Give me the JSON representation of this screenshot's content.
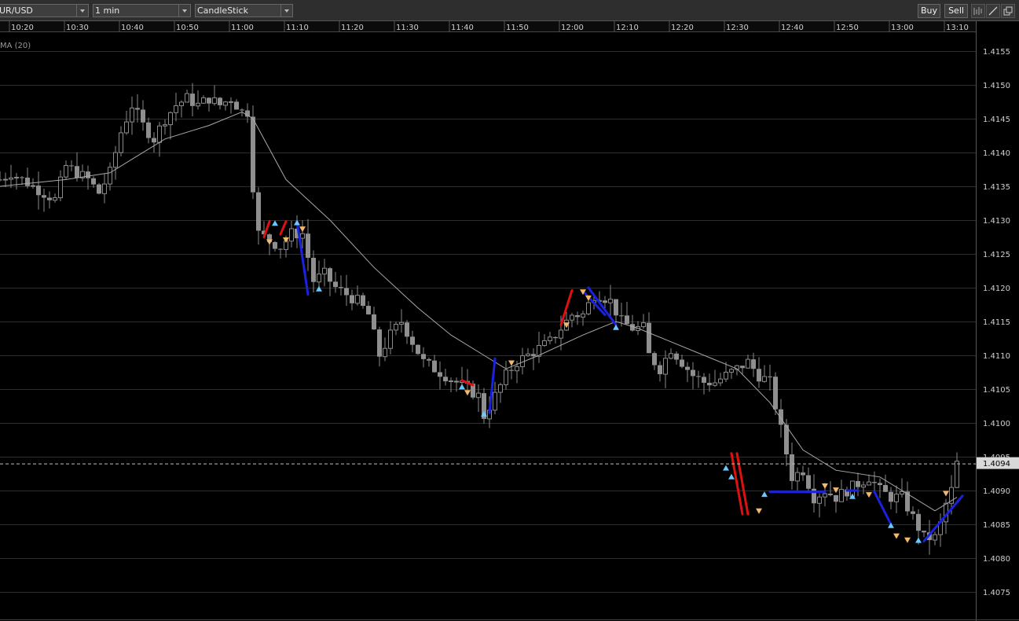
{
  "toolbar": {
    "symbol": "UR/USD",
    "interval": "1 min",
    "chart_style": "CandleStick",
    "buy_label": "Buy",
    "sell_label": "Sell",
    "icons": [
      "indicator-icon",
      "draw-line-icon",
      "popout-icon"
    ]
  },
  "indicator_label": "MA (20)",
  "colors": {
    "background": "#000000",
    "grid": "#2e2e2e",
    "candle": "#8a8a8a",
    "ma_line": "#a8a8a8",
    "signal_up": "#69c8ff",
    "signal_down": "#f5b769",
    "line_red": "#dd1111",
    "line_blue": "#1a22e0"
  },
  "chart_data": {
    "type": "candlestick",
    "symbol": "UR/USD",
    "interval": "1 min",
    "x_tick_labels": [
      "10:20",
      "10:30",
      "10:40",
      "10:50",
      "11:00",
      "11:10",
      "11:20",
      "11:30",
      "11:40",
      "11:50",
      "12:00",
      "12:10",
      "12:20",
      "12:30",
      "12:40",
      "12:50",
      "13:00",
      "13:10"
    ],
    "y_tick_labels": [
      "1.4155",
      "1.4150",
      "1.4145",
      "1.4140",
      "1.4135",
      "1.4130",
      "1.4125",
      "1.4120",
      "1.4115",
      "1.4110",
      "1.4105",
      "1.4100",
      "1.4095",
      "1.4090",
      "1.4085",
      "1.4080",
      "1.4075"
    ],
    "ylim": [
      1.40715,
      1.41615
    ],
    "xlim_minutes_from_10_20": [
      -2,
      172
    ],
    "current_price": "1.4094",
    "close_anchors": [
      [
        -2,
        1.4136
      ],
      [
        0,
        1.4137
      ],
      [
        2,
        1.4136
      ],
      [
        4,
        1.4135
      ],
      [
        6,
        1.4134
      ],
      [
        8,
        1.4133
      ],
      [
        10,
        1.4138
      ],
      [
        12,
        1.4137
      ],
      [
        14,
        1.4136
      ],
      [
        16,
        1.4134
      ],
      [
        18,
        1.4137
      ],
      [
        20,
        1.4143
      ],
      [
        22,
        1.4147
      ],
      [
        24,
        1.4144
      ],
      [
        26,
        1.4142
      ],
      [
        28,
        1.4145
      ],
      [
        30,
        1.4147
      ],
      [
        32,
        1.4148
      ],
      [
        34,
        1.4147
      ],
      [
        36,
        1.4148
      ],
      [
        38,
        1.4147
      ],
      [
        40,
        1.4148
      ],
      [
        42,
        1.4146
      ],
      [
        43,
        1.4146
      ],
      [
        44,
        1.4135
      ],
      [
        45,
        1.4128
      ],
      [
        47,
        1.4127
      ],
      [
        49,
        1.4126
      ],
      [
        51,
        1.4128
      ],
      [
        53,
        1.4128
      ],
      [
        55,
        1.4121
      ],
      [
        57,
        1.4122
      ],
      [
        59,
        1.412
      ],
      [
        61,
        1.4119
      ],
      [
        63,
        1.4118
      ],
      [
        65,
        1.4116
      ],
      [
        67,
        1.411
      ],
      [
        69,
        1.4113
      ],
      [
        71,
        1.4115
      ],
      [
        73,
        1.4112
      ],
      [
        75,
        1.4109
      ],
      [
        77,
        1.4108
      ],
      [
        79,
        1.4107
      ],
      [
        81,
        1.4106
      ],
      [
        83,
        1.4105
      ],
      [
        85,
        1.4104
      ],
      [
        86,
        1.4101
      ],
      [
        88,
        1.4104
      ],
      [
        90,
        1.4107
      ],
      [
        92,
        1.4109
      ],
      [
        94,
        1.411
      ],
      [
        96,
        1.4111
      ],
      [
        98,
        1.4112
      ],
      [
        100,
        1.4114
      ],
      [
        102,
        1.4116
      ],
      [
        104,
        1.4116
      ],
      [
        106,
        1.4119
      ],
      [
        107,
        1.4119
      ],
      [
        109,
        1.4118
      ],
      [
        111,
        1.4115
      ],
      [
        113,
        1.4114
      ],
      [
        115,
        1.4114
      ],
      [
        116,
        1.411
      ],
      [
        118,
        1.4108
      ],
      [
        120,
        1.4111
      ],
      [
        122,
        1.4109
      ],
      [
        124,
        1.4107
      ],
      [
        126,
        1.4106
      ],
      [
        128,
        1.4106
      ],
      [
        130,
        1.4107
      ],
      [
        132,
        1.4108
      ],
      [
        134,
        1.4109
      ],
      [
        136,
        1.4107
      ],
      [
        138,
        1.4106
      ],
      [
        140,
        1.4099
      ],
      [
        142,
        1.4092
      ],
      [
        144,
        1.4093
      ],
      [
        146,
        1.4089
      ],
      [
        148,
        1.409
      ],
      [
        150,
        1.4089
      ],
      [
        152,
        1.409
      ],
      [
        154,
        1.4091
      ],
      [
        156,
        1.4092
      ],
      [
        158,
        1.409
      ],
      [
        160,
        1.4089
      ],
      [
        162,
        1.4089
      ],
      [
        164,
        1.4086
      ],
      [
        166,
        1.4083
      ],
      [
        168,
        1.4083
      ],
      [
        169,
        1.4085
      ],
      [
        170,
        1.4088
      ],
      [
        171,
        1.409
      ],
      [
        172,
        1.4094
      ]
    ],
    "ma_line": {
      "name": "MA (20)",
      "points": [
        [
          -2,
          1.4135
        ],
        [
          10,
          1.4136
        ],
        [
          18,
          1.4137
        ],
        [
          22,
          1.4139
        ],
        [
          28,
          1.4142
        ],
        [
          36,
          1.4144
        ],
        [
          42,
          1.4146
        ],
        [
          44,
          1.4145
        ],
        [
          50,
          1.4136
        ],
        [
          58,
          1.413
        ],
        [
          66,
          1.4123
        ],
        [
          74,
          1.4117
        ],
        [
          80,
          1.4113
        ],
        [
          86,
          1.411
        ],
        [
          90,
          1.4108
        ],
        [
          96,
          1.411
        ],
        [
          104,
          1.4113
        ],
        [
          110,
          1.4115
        ],
        [
          114,
          1.4114
        ],
        [
          120,
          1.4112
        ],
        [
          126,
          1.411
        ],
        [
          132,
          1.4108
        ],
        [
          138,
          1.4103
        ],
        [
          144,
          1.4096
        ],
        [
          150,
          1.4093
        ],
        [
          158,
          1.4092
        ],
        [
          164,
          1.4089
        ],
        [
          168,
          1.4087
        ],
        [
          172,
          1.4089
        ]
      ]
    },
    "signals": [
      {
        "t": 47,
        "p": 1.41268,
        "dir": "down"
      },
      {
        "t": 48,
        "p": 1.41295,
        "dir": "up"
      },
      {
        "t": 50,
        "p": 1.41271,
        "dir": "down"
      },
      {
        "t": 52,
        "p": 1.41296,
        "dir": "up"
      },
      {
        "t": 53,
        "p": 1.41287,
        "dir": "down"
      },
      {
        "t": 56,
        "p": 1.41198,
        "dir": "up"
      },
      {
        "t": 82,
        "p": 1.41053,
        "dir": "up"
      },
      {
        "t": 83,
        "p": 1.41045,
        "dir": "down"
      },
      {
        "t": 86,
        "p": 1.41013,
        "dir": "up"
      },
      {
        "t": 91,
        "p": 1.41089,
        "dir": "down"
      },
      {
        "t": 101,
        "p": 1.41145,
        "dir": "down"
      },
      {
        "t": 104,
        "p": 1.41194,
        "dir": "down"
      },
      {
        "t": 105,
        "p": 1.41185,
        "dir": "down"
      },
      {
        "t": 110,
        "p": 1.41141,
        "dir": "up"
      },
      {
        "t": 130,
        "p": 1.40933,
        "dir": "up"
      },
      {
        "t": 131,
        "p": 1.4092,
        "dir": "up"
      },
      {
        "t": 136,
        "p": 1.4087,
        "dir": "down"
      },
      {
        "t": 137,
        "p": 1.40894,
        "dir": "up"
      },
      {
        "t": 148,
        "p": 1.40907,
        "dir": "down"
      },
      {
        "t": 150,
        "p": 1.40901,
        "dir": "down"
      },
      {
        "t": 153,
        "p": 1.40891,
        "dir": "up"
      },
      {
        "t": 156,
        "p": 1.40894,
        "dir": "down"
      },
      {
        "t": 160,
        "p": 1.40848,
        "dir": "up"
      },
      {
        "t": 161,
        "p": 1.40833,
        "dir": "down"
      },
      {
        "t": 163,
        "p": 1.40827,
        "dir": "down"
      },
      {
        "t": 165,
        "p": 1.40826,
        "dir": "up"
      },
      {
        "t": 170,
        "p": 1.40896,
        "dir": "down"
      }
    ],
    "trend_lines": [
      {
        "color": "red",
        "t1": 46,
        "p1": 1.41275,
        "t2": 47,
        "p2": 1.41298
      },
      {
        "color": "red",
        "t1": 49,
        "p1": 1.41279,
        "t2": 50,
        "p2": 1.41298
      },
      {
        "color": "blue",
        "t1": 52,
        "p1": 1.41298,
        "t2": 54,
        "p2": 1.4119
      },
      {
        "color": "red",
        "t1": 82,
        "p1": 1.41063,
        "t2": 84,
        "p2": 1.41056
      },
      {
        "color": "blue",
        "t1": 87,
        "p1": 1.41015,
        "t2": 88,
        "p2": 1.41095
      },
      {
        "color": "red",
        "t1": 100,
        "p1": 1.41145,
        "t2": 102,
        "p2": 1.41196
      },
      {
        "color": "blue",
        "t1": 105,
        "p1": 1.412,
        "t2": 110,
        "p2": 1.41145
      },
      {
        "color": "blue",
        "t1": 104,
        "p1": 1.41195,
        "t2": 108,
        "p2": 1.4116
      },
      {
        "color": "red",
        "t1": 131,
        "p1": 1.40955,
        "t2": 133,
        "p2": 1.40865
      },
      {
        "color": "red",
        "t1": 132,
        "p1": 1.40955,
        "t2": 134,
        "p2": 1.40865
      },
      {
        "color": "blue",
        "t1": 138,
        "p1": 1.40898,
        "t2": 148,
        "p2": 1.40898
      },
      {
        "color": "blue",
        "t1": 152,
        "p1": 1.409,
        "t2": 154,
        "p2": 1.409
      },
      {
        "color": "blue",
        "t1": 157,
        "p1": 1.40898,
        "t2": 160,
        "p2": 1.4085
      },
      {
        "color": "blue",
        "t1": 166,
        "p1": 1.40825,
        "t2": 173,
        "p2": 1.40892
      }
    ]
  }
}
